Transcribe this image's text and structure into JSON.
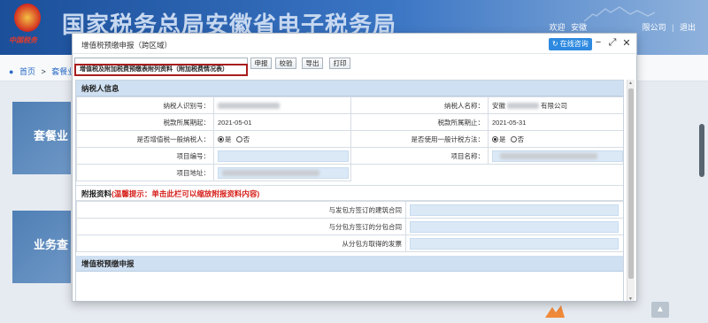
{
  "site": {
    "title": "国家税务总局安徽省电子税务局",
    "emblem_caption": "中国税务",
    "top_links": {
      "welcome": "欢迎",
      "company_prefix": "安徽",
      "company_suffix": "限公司",
      "separator": "|",
      "logout": "退出"
    }
  },
  "breadcrumb": {
    "home": "首页",
    "separator": ">",
    "current": "套餐业"
  },
  "bg_cards": [
    {
      "label": "套餐业"
    },
    {
      "label": "业务查"
    }
  ],
  "modal": {
    "title": "增值税预缴申报（跨区域）",
    "consult_label": "在线咨询",
    "controls": {
      "minimize": "−",
      "maximize": "⤢",
      "close": "✕"
    },
    "toolbar": {
      "declare": "申报",
      "verify": "校验",
      "export": "导出",
      "print": "打印"
    },
    "tab_label": "增值税及附加税费预缴表附列资料（附加税费情况表）"
  },
  "taxpayer_section": {
    "heading": "纳税人信息",
    "taxpayer_id_label": "纳税人识别号：",
    "taxpayer_name_label": "纳税人名称：",
    "taxpayer_name_prefix": "安徽",
    "taxpayer_name_suffix": "有限公司",
    "period_start_label": "税款所属期起：",
    "period_start": "2021-05-01",
    "period_end_label": "税款所属期止：",
    "period_end": "2021-05-31",
    "general_taxpayer_label": "是否增值税一般纳税人：",
    "general_method_label": "是否使用一般计税方法：",
    "radio_yes": "是",
    "radio_no": "否",
    "project_no_label": "项目编号：",
    "project_name_label": "项目名称：",
    "project_address_label": "项目地址："
  },
  "attachment_section": {
    "heading": "附报资料",
    "warning": "(温馨提示：单击此栏可以缩放附报资料内容)",
    "rows": [
      {
        "label": "与发包方签订的建筑合同"
      },
      {
        "label": "与分包方签订的分包合同"
      },
      {
        "label": "从分包方取得的发票"
      }
    ]
  },
  "prepay_section": {
    "heading": "增值税预缴申报"
  }
}
